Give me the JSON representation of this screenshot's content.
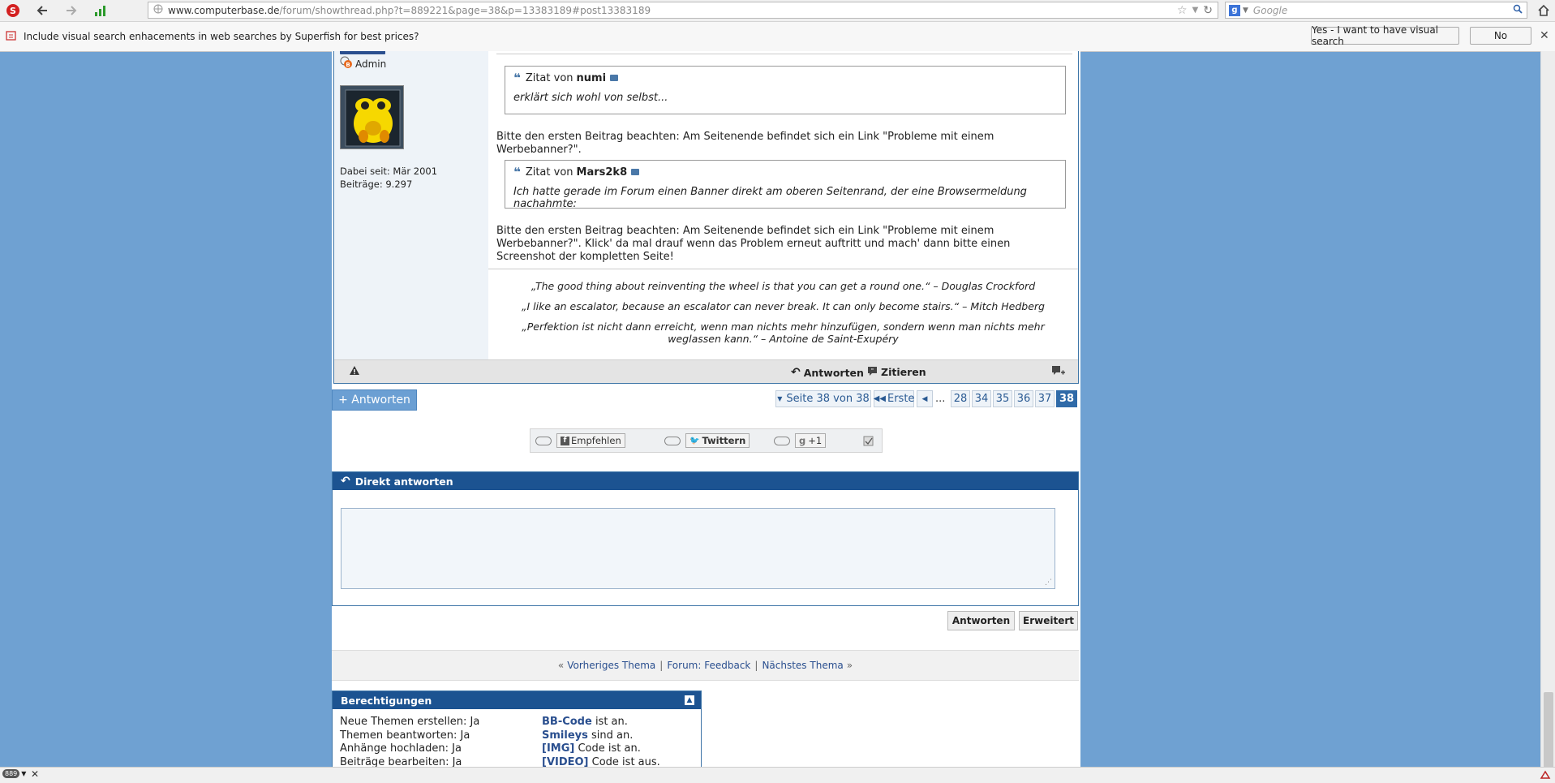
{
  "browser": {
    "url_host": "www.computerbase.de",
    "url_path": "/forum/showthread.php?t=889221&page=38&p=13383189#post13383189",
    "search_placeholder": "Google"
  },
  "notification": {
    "text": "Include visual search enhacements in web searches by Superfish for best prices?",
    "yes_label": "Yes - I want to have visual search",
    "no_label": "No"
  },
  "post": {
    "user_role": "Admin",
    "joined": "Dabei seit: Mär 2001",
    "posts": "Beiträge: 9.297",
    "quote1": {
      "prefix": "Zitat von",
      "author": "numi",
      "text": "erklärt sich wohl von selbst..."
    },
    "text1": "Bitte den ersten Beitrag beachten: Am Seitenende befindet sich ein Link \"Probleme mit einem Werbebanner?\".",
    "quote2": {
      "prefix": "Zitat von",
      "author": "Mars2k8",
      "text": "Ich hatte gerade im Forum einen Banner direkt am oberen Seitenrand, der eine Browsermeldung nachahmte:"
    },
    "text2": "Bitte den ersten Beitrag beachten: Am Seitenende befindet sich ein Link \"Probleme mit einem Werbebanner?\". Klick' da mal drauf wenn das Problem erneut auftritt und mach' dann bitte einen Screenshot der kompletten Seite!",
    "signature": [
      "„The good thing about reinventing the wheel is that you can get a round one.“ – Douglas Crockford",
      "„I like an escalator, because an escalator can never break. It can only become stairs.“ – Mitch Hedberg",
      "„Perfektion ist nicht dann erreicht, wenn man nichts mehr hinzufügen, sondern wenn man nichts mehr weglassen kann.“ – Antoine de Saint-Exupéry"
    ],
    "reply_label": "Antworten",
    "quote_label": "Zitieren"
  },
  "actions": {
    "new_reply": "+ Antworten"
  },
  "pagination": {
    "page_info": "Seite 38 von 38",
    "first": "Erste",
    "ellipsis": "...",
    "pages": [
      "28",
      "34",
      "35",
      "36",
      "37",
      "38"
    ]
  },
  "social": {
    "facebook": "Empfehlen",
    "twitter": "Twittern",
    "google": "+1"
  },
  "quick_reply": {
    "title": "Direkt antworten",
    "submit": "Antworten",
    "advanced": "Erweitert"
  },
  "thread_nav": {
    "prev": "Vorheriges Thema",
    "forum": "Forum: Feedback",
    "next": "Nächstes Thema"
  },
  "permissions": {
    "title": "Berechtigungen",
    "left": [
      "Neue Themen erstellen: Ja",
      "Themen beantworten: Ja",
      "Anhänge hochladen: Ja",
      "Beiträge bearbeiten: Ja"
    ],
    "right": [
      {
        "bold": "BB-Code",
        "rest": " ist an."
      },
      {
        "bold": "Smileys",
        "rest": " sind an."
      },
      {
        "bold": "[IMG]",
        "rest": " Code ist an."
      },
      {
        "bold": "[VIDEO]",
        "rest": " Code ist aus."
      }
    ]
  },
  "statusbar": {
    "badge": "889"
  },
  "colors": {
    "background": "#6fa1d2",
    "header_blue": "#1c5391",
    "link_blue": "#2a4f8f",
    "button_blue": "#6b9fd3"
  }
}
